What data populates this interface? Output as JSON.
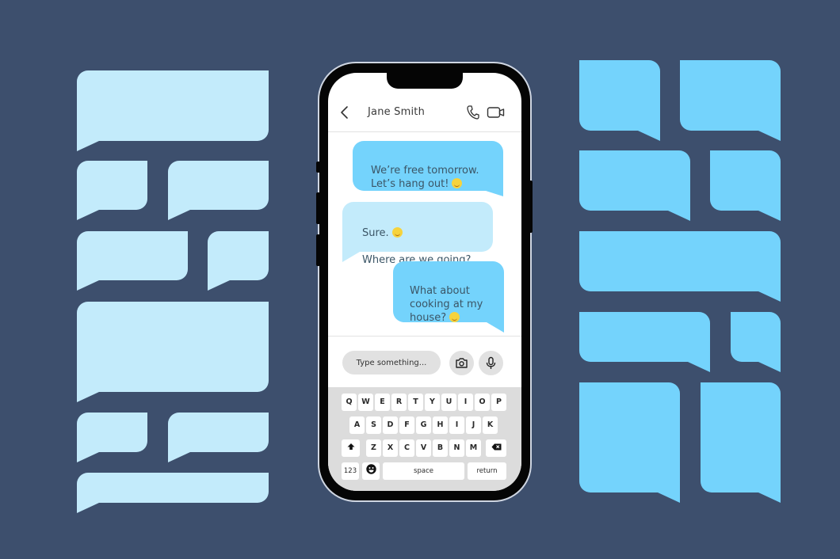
{
  "colors": {
    "background": "#3d4f6d",
    "left_bubbles": "#c3ebfb",
    "right_bubbles": "#74d3fc",
    "outgoing_message": "#74d3fc",
    "incoming_message": "#c3ebfb",
    "emoji": "#f6d33c"
  },
  "chat": {
    "contact_name": "Jane Smith",
    "back_icon": "chevron-left-icon",
    "call_icon": "phone-icon",
    "video_icon": "video-camera-icon",
    "messages": [
      {
        "direction": "outgoing",
        "text": "We’re free tomorrow.\nLet’s hang out!",
        "emoji": "winking-tongue-face"
      },
      {
        "direction": "incoming",
        "text": "Sure.",
        "emoji": "grinning-face",
        "text2": "Where are we going?"
      },
      {
        "direction": "outgoing",
        "text": "What about\ncooking at my\nhouse?",
        "emoji": "grinning-squinting-face"
      }
    ]
  },
  "composer": {
    "placeholder": "Type something...",
    "camera_icon": "camera-icon",
    "mic_icon": "microphone-icon"
  },
  "keyboard": {
    "row1": [
      "Q",
      "W",
      "E",
      "R",
      "T",
      "Y",
      "U",
      "I",
      "O",
      "P"
    ],
    "row2": [
      "A",
      "S",
      "D",
      "F",
      "G",
      "H",
      "I",
      "J",
      "K"
    ],
    "row3": [
      "Z",
      "X",
      "C",
      "V",
      "B",
      "N",
      "M"
    ],
    "shift_icon": "shift-arrow-icon",
    "backspace_icon": "backspace-icon",
    "numbers_label": "123",
    "emoji_icon": "emoji-face-icon",
    "space_label": "space",
    "return_label": "return"
  }
}
